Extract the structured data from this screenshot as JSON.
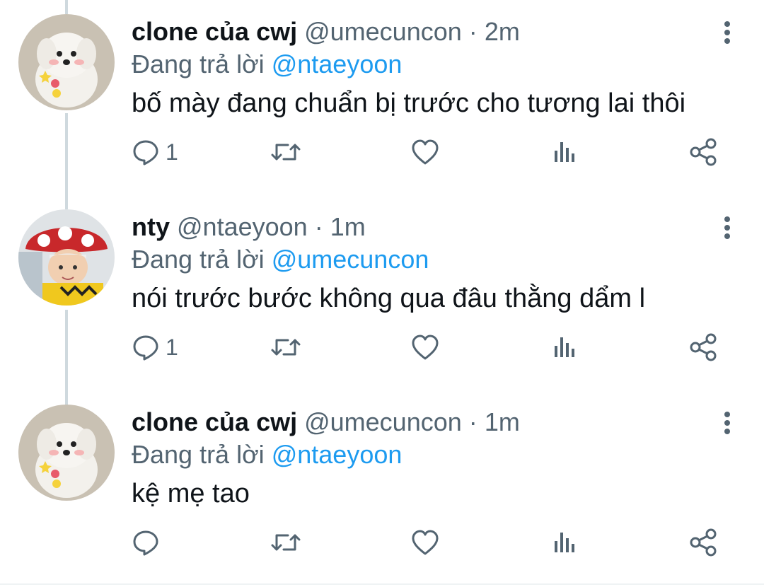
{
  "tweets": [
    {
      "name": "clone của cwj",
      "handle": "@umecuncon",
      "separator": "·",
      "time": "2m",
      "replying_prefix": "Đang trả lời",
      "replying_to": "@ntaeyoon",
      "text": "bố mày đang chuẩn bị trước cho tương lai thôi",
      "reply_count": "1",
      "avatar": "white-puppy-avatar"
    },
    {
      "name": "nty",
      "handle": "@ntaeyoon",
      "separator": "·",
      "time": "1m",
      "replying_prefix": "Đang trả lời",
      "replying_to": "@umecuncon",
      "text": "nói trước bước không qua đâu thằng dẩm l",
      "reply_count": "1",
      "avatar": "mushroom-hat-person-avatar"
    },
    {
      "name": "clone của cwj",
      "handle": "@umecuncon",
      "separator": "·",
      "time": "1m",
      "replying_prefix": "Đang trả lời",
      "replying_to": "@ntaeyoon",
      "text": "kệ mẹ tao",
      "reply_count": "",
      "avatar": "white-puppy-avatar"
    }
  ],
  "colors": {
    "link": "#1d9bf0",
    "secondary_text": "#536471",
    "primary_text": "#0f1419",
    "thread_line": "#cfd9de"
  },
  "icons": [
    "reply-icon",
    "retweet-icon",
    "like-icon",
    "views-icon",
    "share-icon",
    "more-icon"
  ]
}
